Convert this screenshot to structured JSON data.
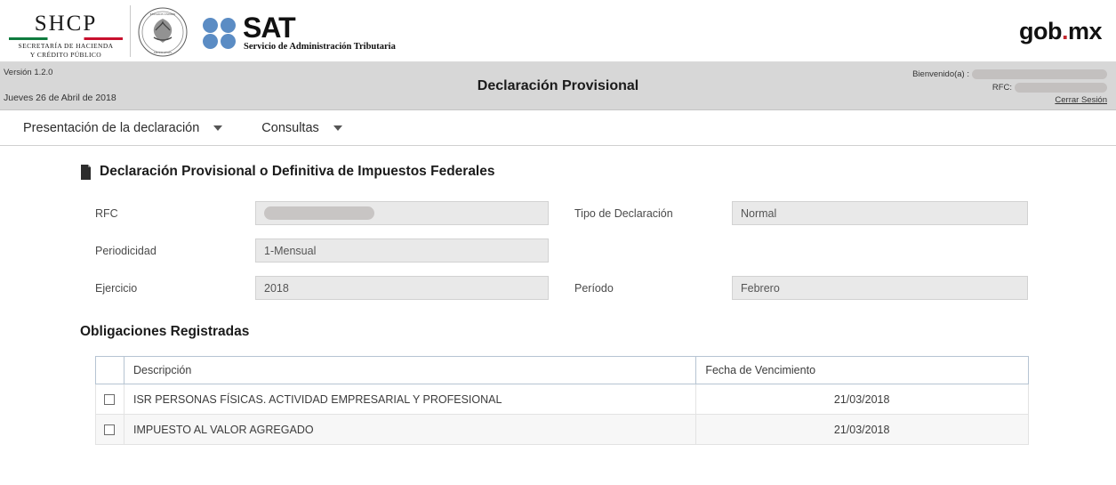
{
  "brand": {
    "shcp_word": "SHCP",
    "shcp_sub_line1": "SECRETARÍA DE HACIENDA",
    "shcp_sub_line2": "Y CRÉDITO PÚBLICO",
    "sat_word": "SAT",
    "sat_tagline": "Servicio de Administración Tributaria",
    "gob_prefix": "gob",
    "gob_dot": ".",
    "gob_suffix": "mx",
    "accent_red": "#c1272d",
    "accent_green": "#0f7b3e",
    "sat_blue": "#5b8cc4"
  },
  "info_bar": {
    "version": "Versión 1.2.0",
    "date": "Jueves 26 de Abril de 2018",
    "page_subtitle": "Declaración Provisional",
    "welcome_label": "Bienvenido(a) :",
    "welcome_value": "",
    "rfc_label": "RFC:",
    "rfc_value": "",
    "logout_label": "Cerrar Sesión"
  },
  "nav": {
    "items": [
      {
        "label": "Presentación de la declaración",
        "has_caret": true
      },
      {
        "label": "Consultas",
        "has_caret": true
      }
    ]
  },
  "main": {
    "section_title": "Declaración Provisional o Definitiva de Impuestos Federales",
    "fields": {
      "rfc": {
        "label": "RFC",
        "value": ""
      },
      "periodicidad": {
        "label": "Periodicidad",
        "value": "1-Mensual"
      },
      "ejercicio": {
        "label": "Ejercicio",
        "value": "2018"
      },
      "tipo_declaracion": {
        "label": "Tipo de Declaración",
        "value": "Normal"
      },
      "periodo": {
        "label": "Período",
        "value": "Febrero"
      }
    },
    "obligations": {
      "title": "Obligaciones Registradas",
      "columns": {
        "check": "",
        "descripcion": "Descripción",
        "fecha": "Fecha de Vencimiento"
      },
      "rows": [
        {
          "checked": false,
          "descripcion": "ISR PERSONAS FÍSICAS. ACTIVIDAD EMPRESARIAL Y PROFESIONAL",
          "fecha": "21/03/2018"
        },
        {
          "checked": false,
          "descripcion": "IMPUESTO AL VALOR AGREGADO",
          "fecha": "21/03/2018"
        }
      ]
    }
  }
}
